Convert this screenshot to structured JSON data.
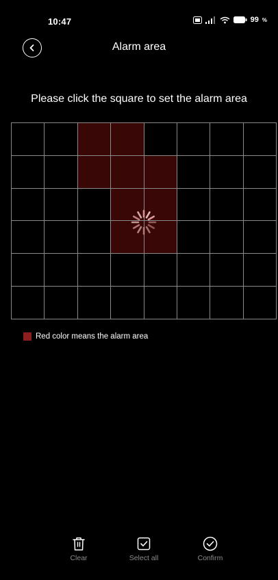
{
  "status_bar": {
    "time": "10:47",
    "battery": "99"
  },
  "header": {
    "title": "Alarm area"
  },
  "instruction": "Please click the square to set the alarm area",
  "grid": {
    "columns": 8,
    "rows": 6,
    "selected_cells": [
      [
        0,
        2
      ],
      [
        0,
        3
      ],
      [
        1,
        2
      ],
      [
        1,
        3
      ],
      [
        1,
        4
      ],
      [
        2,
        3
      ],
      [
        2,
        4
      ],
      [
        3,
        3
      ],
      [
        3,
        4
      ]
    ],
    "selected_color": "#3a0707",
    "line_color": "#8a8a8a"
  },
  "legend": {
    "label": "Red color means the alarm area",
    "swatch_color": "#8b1e1e"
  },
  "toolbar": {
    "clear_label": "Clear",
    "select_all_label": "Select all",
    "confirm_label": "Confirm"
  },
  "icons": {
    "back": "chevron-left-icon",
    "clear": "trash-icon",
    "select_all": "checkbox-icon",
    "confirm": "check-circle-icon",
    "loading": "loading-spinner-icon"
  }
}
